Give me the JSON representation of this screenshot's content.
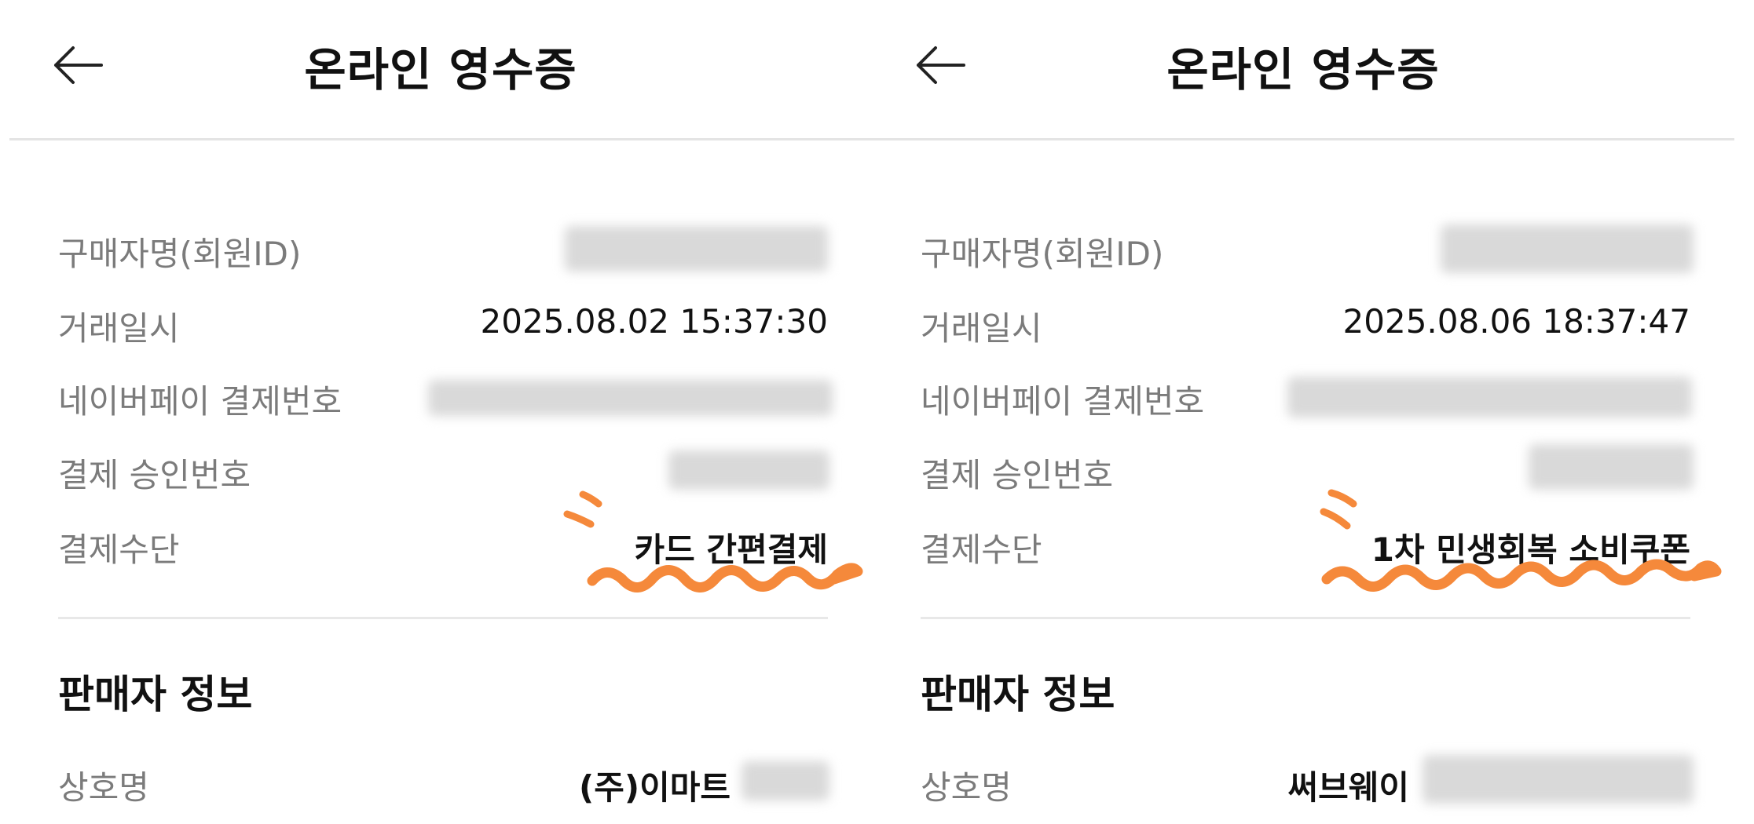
{
  "panels": [
    {
      "title": "온라인 영수증",
      "buyer_label": "구매자명(회원ID)",
      "datetime_label": "거래일시",
      "datetime_value": "2025.08.02 15:37:30",
      "naverpay_label": "네이버페이 결제번호",
      "approval_label": "결제 승인번호",
      "method_label": "결제수단",
      "method_value": "카드 간편결제",
      "seller_section": "판매자 정보",
      "company_label": "상호명",
      "company_value": "(주)이마트"
    },
    {
      "title": "온라인 영수증",
      "buyer_label": "구매자명(회원ID)",
      "datetime_label": "거래일시",
      "datetime_value": "2025.08.06 18:37:47",
      "naverpay_label": "네이버페이 결제번호",
      "approval_label": "결제 승인번호",
      "method_label": "결제수단",
      "method_value": "1차 민생회복 소비쿠폰",
      "seller_section": "판매자 정보",
      "company_label": "상호명",
      "company_value": "써브웨이"
    }
  ],
  "icons": {
    "back": "arrow-left-icon"
  },
  "colors": {
    "annotation": "#f5893b",
    "label": "#7b7b7b",
    "value": "#111111",
    "divider": "#e4e4e4"
  }
}
